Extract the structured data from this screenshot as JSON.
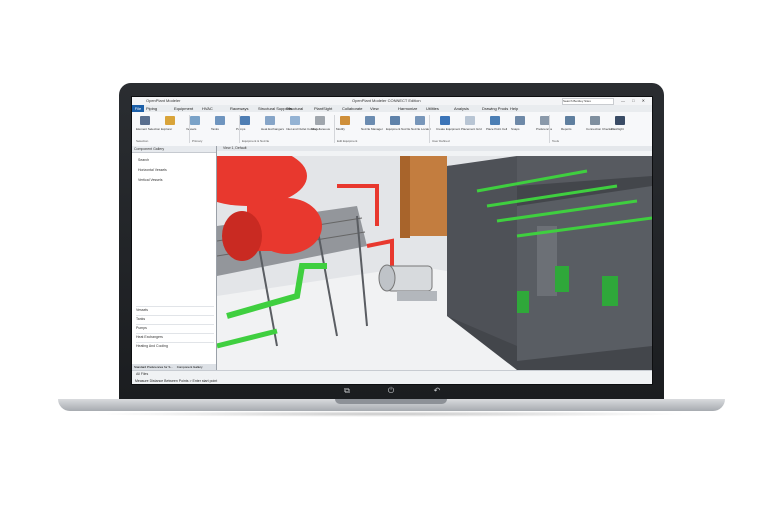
{
  "app": {
    "window_title": "OpenPlant Modeler CONNECT Edition",
    "app_name": "OpenPlant Modeler",
    "search_placeholder": "Search Bentley Sites",
    "window_buttons": "— □ ✕"
  },
  "tabs": [
    "File",
    "Piping",
    "Equipment",
    "HVAC",
    "Raceways",
    "Structural Supports",
    "Structural",
    "PlantSight",
    "Collaborate",
    "View",
    "Harmonize",
    "Utilities",
    "Analysis",
    "Drawing Prods",
    "Help"
  ],
  "ribbon": {
    "buttons": [
      {
        "label": "Element Selection",
        "color": "#5a6f8f"
      },
      {
        "label": "Explorer",
        "color": "#d9a43a"
      },
      {
        "label": "Vessels",
        "color": "#7aa2c8"
      },
      {
        "label": "Tanks",
        "color": "#6f95bf"
      },
      {
        "label": "Pumps",
        "color": "#4f7eb4"
      },
      {
        "label": "Heat Exchangers",
        "color": "#86a5c8"
      },
      {
        "label": "Inlet and Outlet Cooling",
        "color": "#94b3d4"
      },
      {
        "label": "Miscellaneous",
        "color": "#a0a6ad"
      },
      {
        "label": "Modify",
        "color": "#cf8f3a"
      },
      {
        "label": "Nozzle Manager",
        "color": "#6b8cb1"
      },
      {
        "label": "Equipment Nozzle",
        "color": "#5f82aa"
      },
      {
        "label": "Nozzle Locator",
        "color": "#7796ba"
      },
      {
        "label": "Create Equipment",
        "color": "#3b74b8"
      },
      {
        "label": "Placement Grid",
        "color": "#b8c5d4"
      },
      {
        "label": "Place Point Cell",
        "color": "#4c7fb5"
      },
      {
        "label": "Snaps",
        "color": "#6e89a8"
      },
      {
        "label": "Preferences",
        "color": "#8a99aa"
      },
      {
        "label": "Reports",
        "color": "#5f7f9f"
      },
      {
        "label": "Connection Checker",
        "color": "#7f8f9f"
      },
      {
        "label": "Flashlight",
        "color": "#3a4c66"
      }
    ],
    "groups": [
      "Selection",
      "Primary",
      "Equipment & Nozzle",
      "Edit Equipment",
      "User Defined",
      "Tools"
    ]
  },
  "panel": {
    "title": "Component Gallery",
    "items": [
      "Horizontal Vessels",
      "Vertical Vessels",
      "Search"
    ],
    "categories": [
      "Vessels",
      "Tanks",
      "Pumps",
      "Heat Exchangers",
      "Heating And Cooling"
    ],
    "bottom_tabs": [
      "Standard Preferences for S...",
      "Component Gallery"
    ]
  },
  "view": {
    "title": "View 1, Default"
  },
  "statusbar": {
    "field": "All Files",
    "message": "Measure Distance Between Points > Enter start point"
  },
  "colors": {
    "accent": "#1b5fa8",
    "vessel_red": "#e8382e",
    "pipe_green": "#3fcf3f",
    "building_gray": "#5d6066",
    "tank_orange": "#c37d3f"
  }
}
